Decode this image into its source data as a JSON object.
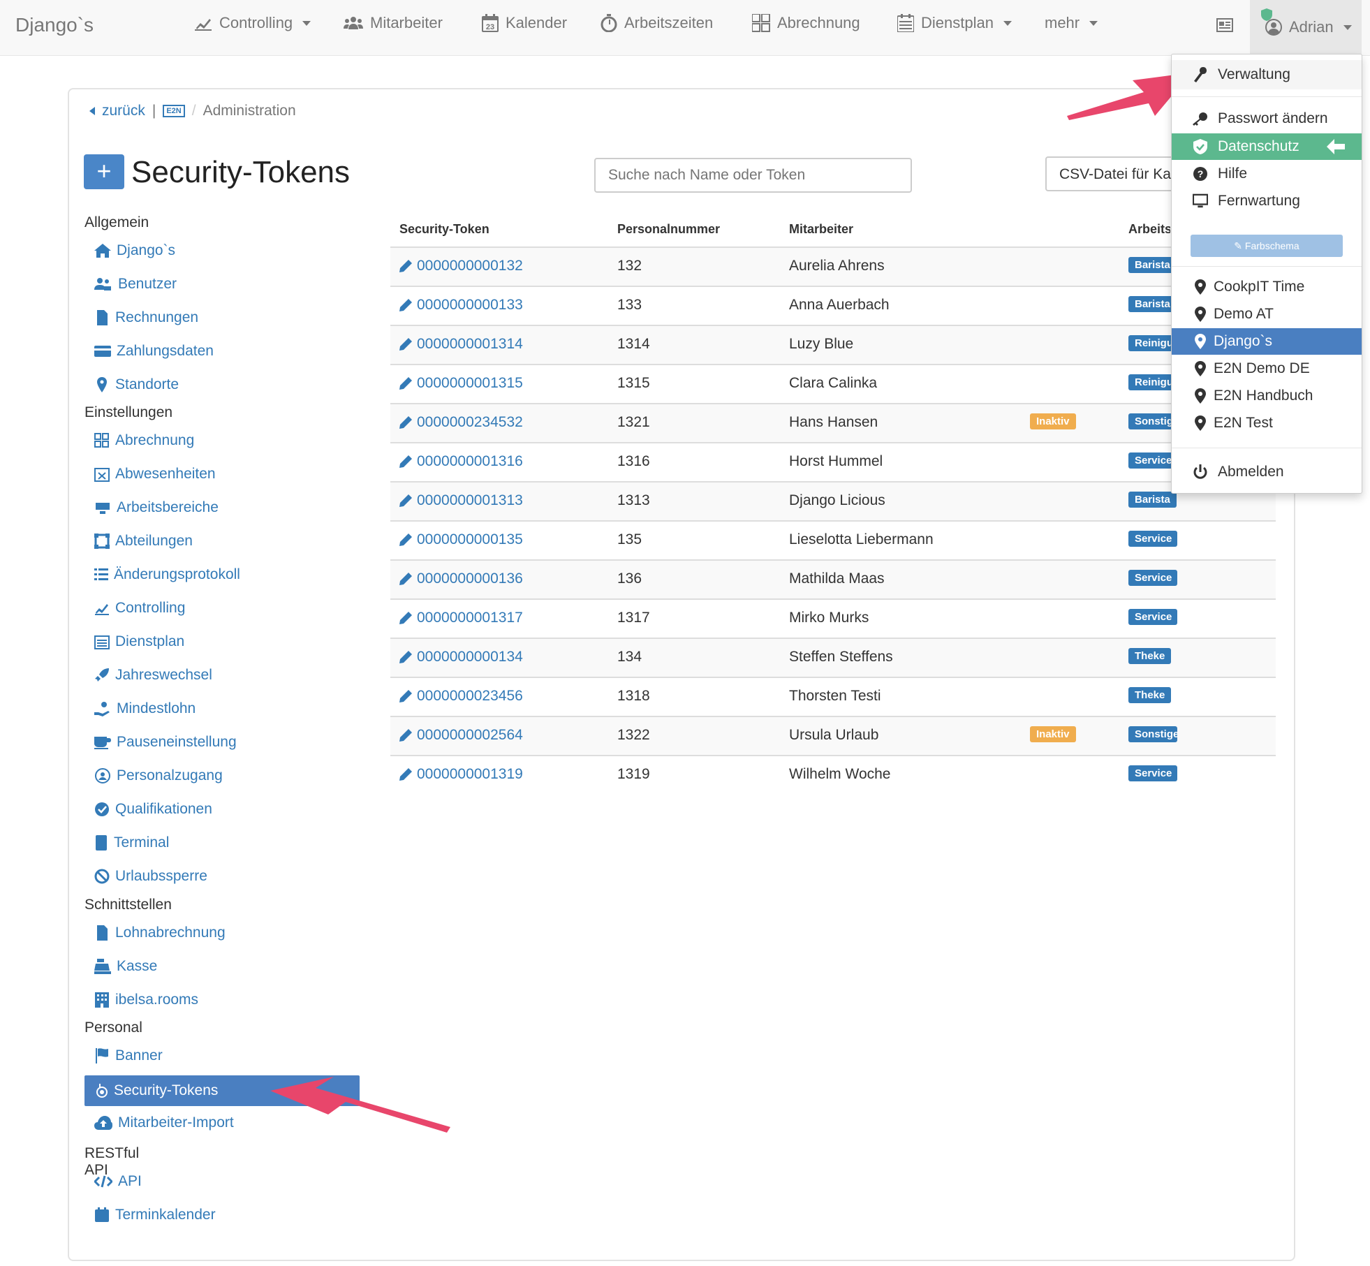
{
  "navbar": {
    "brand": "Django`s",
    "items": [
      {
        "label": "Controlling",
        "icon": "chart-icon",
        "dropdown": true
      },
      {
        "label": "Mitarbeiter",
        "icon": "users-icon",
        "dropdown": false
      },
      {
        "label": "Kalender",
        "icon": "calendar-icon",
        "dropdown": false
      },
      {
        "label": "Arbeitszeiten",
        "icon": "stopwatch-icon",
        "dropdown": false
      },
      {
        "label": "Abrechnung",
        "icon": "billing-icon",
        "dropdown": false
      },
      {
        "label": "Dienstplan",
        "icon": "schedule-icon",
        "dropdown": true
      },
      {
        "label": "mehr",
        "icon": "",
        "dropdown": true
      }
    ],
    "user": "Adrian",
    "calendar_day": "23"
  },
  "breadcrumb": {
    "back": "zurück",
    "sep": "|",
    "badge": "E2N",
    "slash": "/",
    "current": "Administration"
  },
  "page": {
    "add_label": "+",
    "title": "Security-Tokens",
    "search_placeholder": "Suche nach Name oder Token",
    "csv_button": "CSV-Datei für Kassen"
  },
  "sidebar": {
    "sections": [
      {
        "heading": "Allgemein",
        "items": [
          "Django`s",
          "Benutzer",
          "Rechnungen",
          "Zahlungsdaten",
          "Standorte"
        ]
      },
      {
        "heading": "Einstellungen",
        "items": [
          "Abrechnung",
          "Abwesenheiten",
          "Arbeitsbereiche",
          "Abteilungen",
          "Änderungsprotokoll",
          "Controlling",
          "Dienstplan",
          "Jahreswechsel",
          "Mindestlohn",
          "Pauseneinstellung",
          "Personalzugang",
          "Qualifikationen",
          "Terminal",
          "Urlaubssperre"
        ]
      },
      {
        "heading": "Schnittstellen",
        "items": [
          "Lohnabrechnung",
          "Kasse",
          "ibelsa.rooms"
        ]
      },
      {
        "heading": "Personal",
        "items": [
          "Banner",
          "Security-Tokens",
          "Mitarbeiter-Import"
        ]
      },
      {
        "heading": "RESTful API",
        "items": [
          "API",
          "Terminkalender"
        ]
      }
    ],
    "active": "Security-Tokens"
  },
  "table": {
    "headers": [
      "Security-Token",
      "Personalnummer",
      "Mitarbeiter",
      "Arbeitsbereiche"
    ],
    "rows": [
      {
        "token": "0000000000132",
        "nr": "132",
        "name": "Aurelia Ahrens",
        "status": "",
        "area": "Barista"
      },
      {
        "token": "0000000000133",
        "nr": "133",
        "name": "Anna Auerbach",
        "status": "",
        "area": "Barista"
      },
      {
        "token": "0000000001314",
        "nr": "1314",
        "name": "Luzy Blue",
        "status": "",
        "area": "Reinigung"
      },
      {
        "token": "0000000001315",
        "nr": "1315",
        "name": "Clara Calinka",
        "status": "",
        "area": "Reinigung"
      },
      {
        "token": "0000000234532",
        "nr": "1321",
        "name": "Hans Hansen",
        "status": "Inaktiv",
        "area": "Sonstiges"
      },
      {
        "token": "0000000001316",
        "nr": "1316",
        "name": "Horst Hummel",
        "status": "",
        "area": "Service"
      },
      {
        "token": "0000000001313",
        "nr": "1313",
        "name": "Django Licious",
        "status": "",
        "area": "Barista"
      },
      {
        "token": "0000000000135",
        "nr": "135",
        "name": "Lieselotta Liebermann",
        "status": "",
        "area": "Service"
      },
      {
        "token": "0000000000136",
        "nr": "136",
        "name": "Mathilda Maas",
        "status": "",
        "area": "Service"
      },
      {
        "token": "0000000001317",
        "nr": "1317",
        "name": "Mirko Murks",
        "status": "",
        "area": "Service"
      },
      {
        "token": "0000000000134",
        "nr": "134",
        "name": "Steffen Steffens",
        "status": "",
        "area": "Theke"
      },
      {
        "token": "0000000023456",
        "nr": "1318",
        "name": "Thorsten Testi",
        "status": "",
        "area": "Theke"
      },
      {
        "token": "0000000002564",
        "nr": "1322",
        "name": "Ursula Urlaub",
        "status": "Inaktiv",
        "area": "Sonstiges"
      },
      {
        "token": "0000000001319",
        "nr": "1319",
        "name": "Wilhelm Woche",
        "status": "",
        "area": "Service"
      }
    ]
  },
  "dropdown": {
    "admin": "Verwaltung",
    "password": "Passwort ändern",
    "privacy": "Datenschutz",
    "help": "Hilfe",
    "remote": "Fernwartung",
    "color_scheme": "Farbschema",
    "locations": [
      "CookpIT Time",
      "Demo AT",
      "Django`s",
      "E2N Demo DE",
      "E2N Handbuch",
      "E2N Test"
    ],
    "active_location": "Django`s",
    "logout": "Abmelden"
  },
  "colors": {
    "primary": "#337ab7",
    "active": "#4a7fc1",
    "privacy": "#5cb88e",
    "inactive": "#f0ad4e",
    "arrow": "#e8466b"
  }
}
